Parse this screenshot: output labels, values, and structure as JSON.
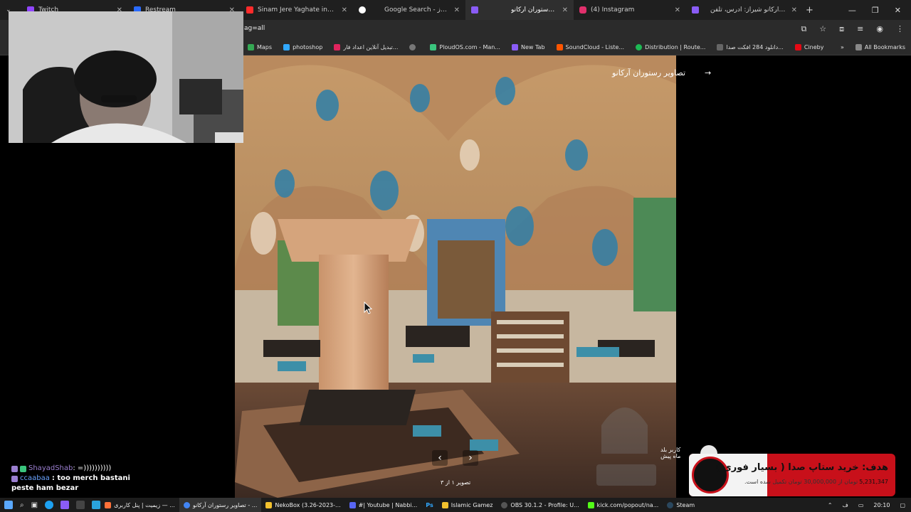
{
  "browser": {
    "tabs": [
      {
        "title": "Twitch",
        "color": "#9146ff"
      },
      {
        "title": "Restream",
        "color": "#2a6bff"
      },
      {
        "title": "Sinam Jere Yaghate in irani",
        "color": "#ff2b2b"
      },
      {
        "title": "Google Search - آرکانو شیراز",
        "color": "#ffffff"
      },
      {
        "title": "تصاویر رستوران آرکانو",
        "color": "#8a5cf6",
        "active": true
      },
      {
        "title": "(4) Instagram",
        "color": "#e1306c"
      },
      {
        "title": "رستوران آرکانو شیراز: آدرس، تلفن",
        "color": "#8a5cf6"
      }
    ],
    "new_tab_symbol": "+",
    "window_controls": [
      "—",
      "❐",
      "✕"
    ],
    "url": "ag=all",
    "bookmarks": [
      {
        "label": "Maps",
        "color": "#34a853"
      },
      {
        "label": "photoshop",
        "color": "#31a8ff"
      },
      {
        "label": "تبدیل آنلاین اعداد فار...",
        "color": "#e0245e"
      },
      {
        "label": "",
        "color": "#777777"
      },
      {
        "label": "PloudOS.com - Man...",
        "color": "#3ac47d"
      },
      {
        "label": "New Tab",
        "color": "#8a5cf6"
      },
      {
        "label": "SoundCloud - Liste...",
        "color": "#ff5500"
      },
      {
        "label": "Distribution | Route...",
        "color": "#1db954"
      },
      {
        "label": "دانلود 284 افکت صدا...",
        "color": "#666666"
      },
      {
        "label": "Cineby",
        "color": "#e50914"
      }
    ],
    "all_bookmarks": "All Bookmarks"
  },
  "gallery": {
    "title": "تصاویر رستوران آرکانو",
    "arrow": "→",
    "prev": "‹",
    "next": "›",
    "counter": "تصویر ۱ از ۳",
    "user_name": "کاربر بلد",
    "user_time": "ماه پیش"
  },
  "chat": {
    "messages": [
      {
        "user": "ShayadShab",
        "text": ": =))))))))))",
        "user_color": "#9b7fd0"
      },
      {
        "user": "ccaabaa",
        "text": ": too merch bastani",
        "user_color": "#6aa3ff"
      },
      {
        "user": "",
        "text": "peste ham bezar",
        "user_color": "#ffffff"
      }
    ]
  },
  "goal": {
    "title": "هدف: خرید ستاپ صدا ( بسیار فوری )",
    "amount": "5,231,347",
    "subtitle": "تومان از 30,000,000 تومان تکمیل شده است.",
    "progress_fraction": 0.174
  },
  "taskbar": {
    "items": [
      {
        "label": "زیمیت | پنل کاربری — ...",
        "color": "#ff7139"
      },
      {
        "label": "تصاویر رستوران آرکانو - ...",
        "color": "#4285f4",
        "active": true
      },
      {
        "label": "NekoBox (3.26-2023-...",
        "color": "#f2c12e"
      },
      {
        "label": "#| Youtube | Nabbi...",
        "color": "#5865f2"
      },
      {
        "label": "Ps",
        "color": "#31a8ff"
      },
      {
        "label": "Islamic Gamez",
        "color": "#f2c12e"
      },
      {
        "label": "OBS 30.1.2 - Profile: U...",
        "color": "#302e31"
      },
      {
        "label": "kick.com/popout/na...",
        "color": "#53fc18"
      },
      {
        "label": "Steam",
        "color": "#1b2838"
      }
    ],
    "tray_lang": "ف",
    "time": "20:10"
  }
}
